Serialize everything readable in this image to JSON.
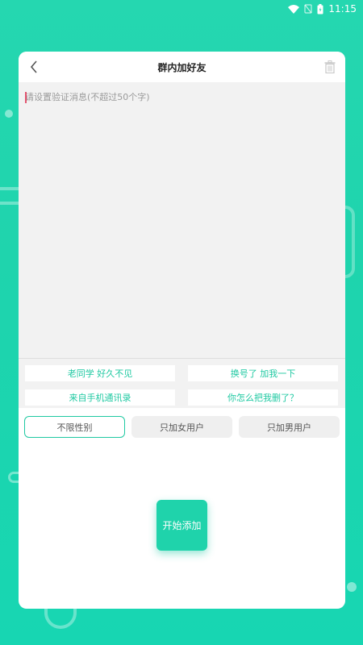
{
  "status_bar": {
    "time": "11:15",
    "icons": [
      "wifi-icon",
      "signal-off-icon",
      "battery-icon"
    ]
  },
  "header": {
    "title": "群内加好友",
    "back_icon": "back-chevron-icon",
    "trash_icon": "trash-icon"
  },
  "message": {
    "value": "",
    "placeholder": "请设置验证消息(不超过50个字)"
  },
  "quick_messages": [
    "老同学 好久不见",
    "换号了 加我一下",
    "来自手机通讯录",
    "你怎么把我删了？"
  ],
  "gender_filter": {
    "options": [
      "不限性别",
      "只加女用户",
      "只加男用户"
    ],
    "selected": "不限性别"
  },
  "start_button": {
    "label": "开始添加"
  },
  "colors": {
    "accent": "#1fd3ab",
    "background": "#25d7b0",
    "chip_text": "#1fc9a2"
  }
}
